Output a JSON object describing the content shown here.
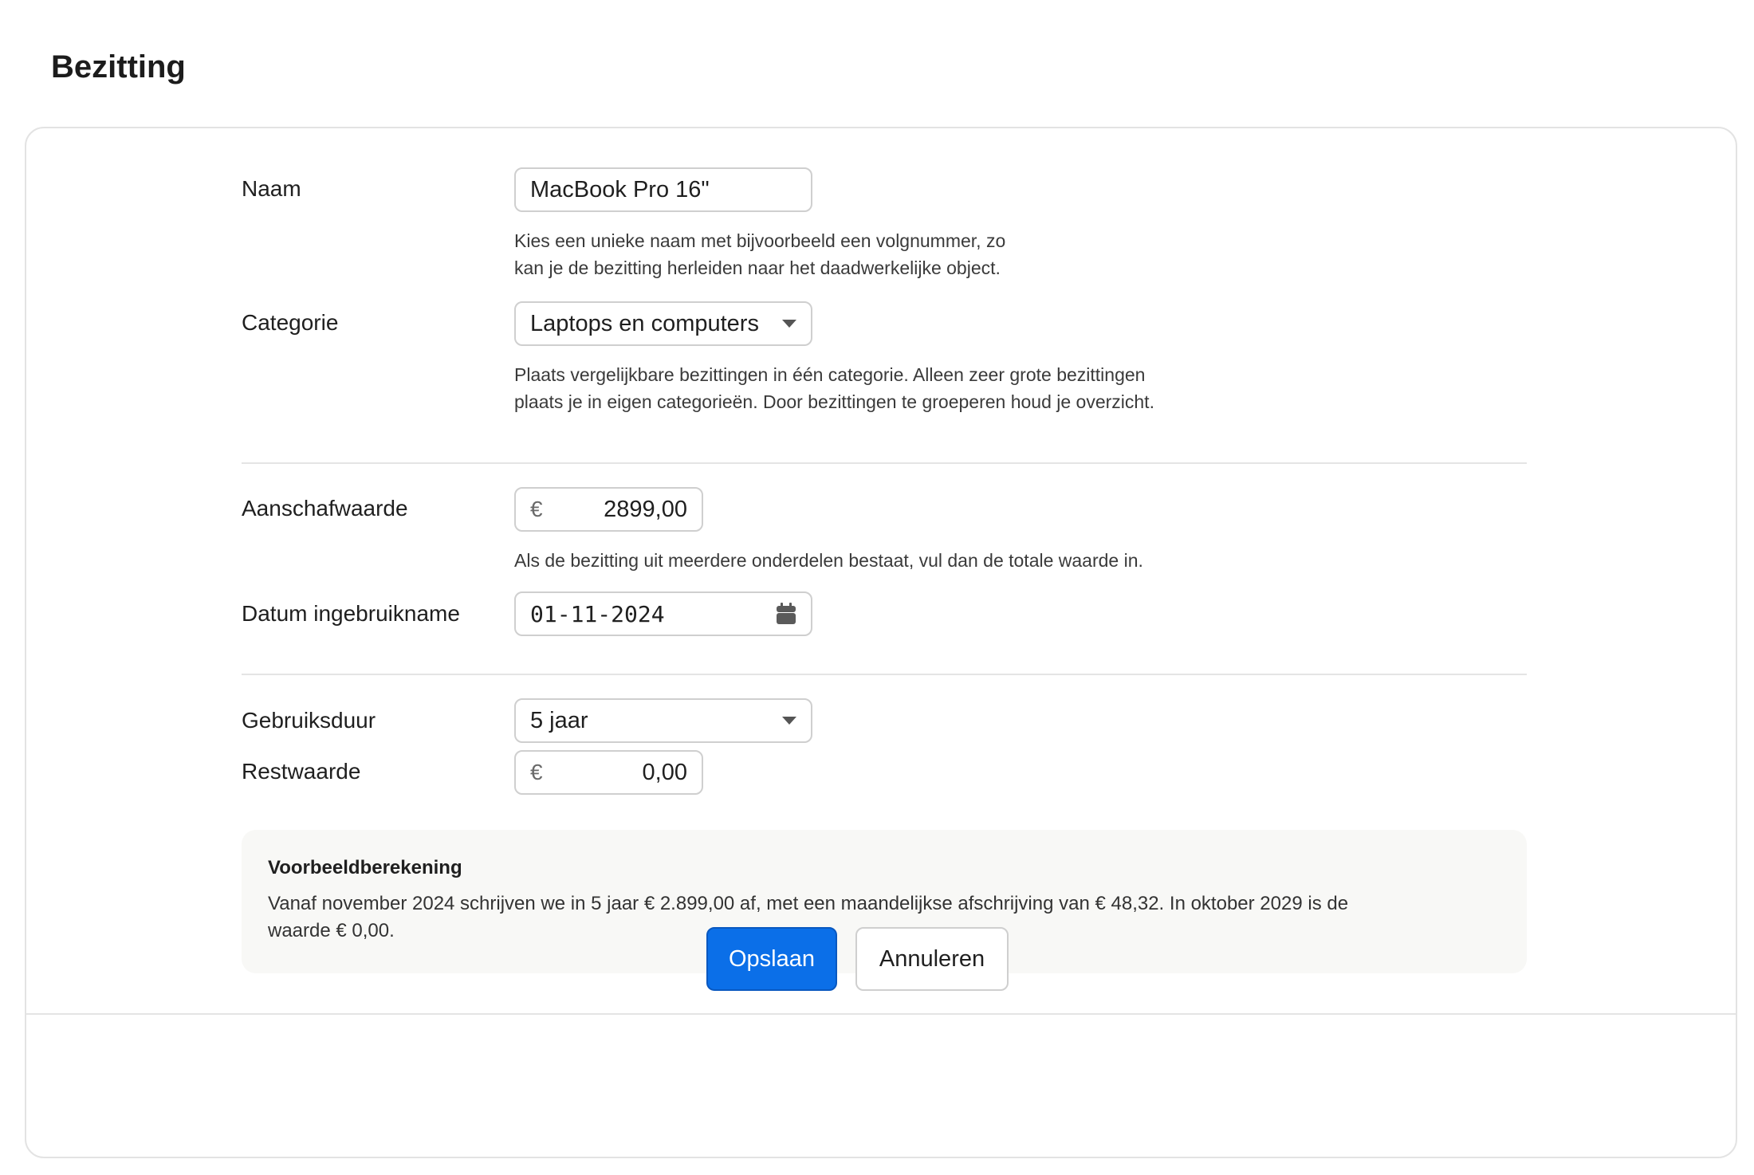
{
  "page": {
    "title": "Bezitting"
  },
  "form": {
    "name": {
      "label": "Naam",
      "value": "MacBook Pro 16\"",
      "help_line1": "Kies een unieke naam met bijvoorbeeld een volgnummer, zo",
      "help_line2": "kan je de bezitting herleiden naar het daadwerkelijke object."
    },
    "category": {
      "label": "Categorie",
      "value": "Laptops en computers",
      "help_line1": "Plaats vergelijkbare bezittingen in één categorie. Alleen zeer grote bezittingen",
      "help_line2": "plaats je in eigen categorieën. Door bezittingen te groeperen houd je overzicht."
    },
    "purchase_value": {
      "label": "Aanschafwaarde",
      "currency": "€",
      "value": "2899,00",
      "help": "Als de bezitting uit meerdere onderdelen bestaat, vul dan de totale waarde in."
    },
    "start_date": {
      "label": "Datum ingebruikname",
      "value": "01-11-2024",
      "icon": "calendar-icon"
    },
    "duration": {
      "label": "Gebruiksduur",
      "value": "5 jaar"
    },
    "residual_value": {
      "label": "Restwaarde",
      "currency": "€",
      "value": "0,00"
    }
  },
  "example": {
    "title": "Voorbeeldberekening",
    "text_line1": "Vanaf november 2024 schrijven we in 5 jaar € 2.899,00 af, met een maandelijkse afschrijving van € 48,32. In oktober 2029 is de",
    "text_line2": "waarde € 0,00."
  },
  "actions": {
    "save_label": "Opslaan",
    "cancel_label": "Annuleren"
  },
  "colors": {
    "primary": "#0b6fe8",
    "example_bg": "#f8f8f6",
    "border": "#cfcfcf"
  }
}
